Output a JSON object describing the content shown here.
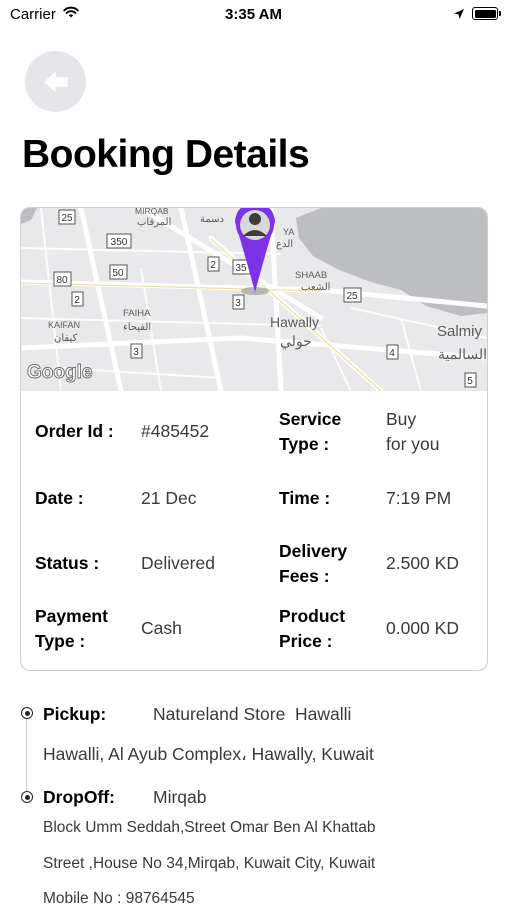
{
  "status_bar": {
    "carrier": "Carrier",
    "time": "3:35 AM"
  },
  "header": {
    "title": "Booking Details"
  },
  "map": {
    "brand": "Google",
    "labels": [
      {
        "text": "MIRQAB"
      },
      {
        "text": "المرقاب"
      },
      {
        "text": "دسمة"
      },
      {
        "text": "YA"
      },
      {
        "text": "الدع"
      },
      {
        "text": "SHAAB"
      },
      {
        "text": "الشعب"
      },
      {
        "text": "FAIHA"
      },
      {
        "text": "الفيحاء"
      },
      {
        "text": "KAIFAN"
      },
      {
        "text": "كيفان"
      },
      {
        "text": "Hawally"
      },
      {
        "text": "حولي"
      },
      {
        "text": "Salmiy"
      },
      {
        "text": "السالمية"
      }
    ],
    "road_badges": [
      "25",
      "350",
      "50",
      "80",
      "2",
      "3",
      "2",
      "35",
      "3",
      "25",
      "4",
      "5"
    ]
  },
  "details": {
    "order_id": {
      "label": "Order Id :",
      "value": "#485452"
    },
    "service_type": {
      "label_1": "Service",
      "label_2": "Type :",
      "value_1": "Buy",
      "value_2": "for you"
    },
    "date": {
      "label": "Date :",
      "value": "21 Dec"
    },
    "time": {
      "label": "Time :",
      "value": "7:19 PM"
    },
    "status": {
      "label": "Status :",
      "value": "Delivered"
    },
    "delivery_fees": {
      "label_1": "Delivery",
      "label_2": "Fees :",
      "value": "2.500 KD"
    },
    "payment_type": {
      "label_1": "Payment",
      "label_2": "Type :",
      "value": "Cash"
    },
    "product_price": {
      "label_1": "Product",
      "label_2": "Price :",
      "value": "0.000 KD"
    }
  },
  "pickup": {
    "label": "Pickup:",
    "name": "Natureland Store  Hawalli",
    "address": "Hawalli, Al Ayub Complex، Hawally, Kuwait"
  },
  "dropoff": {
    "label": "DropOff:",
    "name": "Mirqab",
    "address_line_1": "Block Umm Seddah,Street Omar Ben Al Khattab",
    "address_line_2": "Street ,House No 34,Mirqab, Kuwait City, Kuwait",
    "mobile": "Mobile No : 98764545"
  }
}
